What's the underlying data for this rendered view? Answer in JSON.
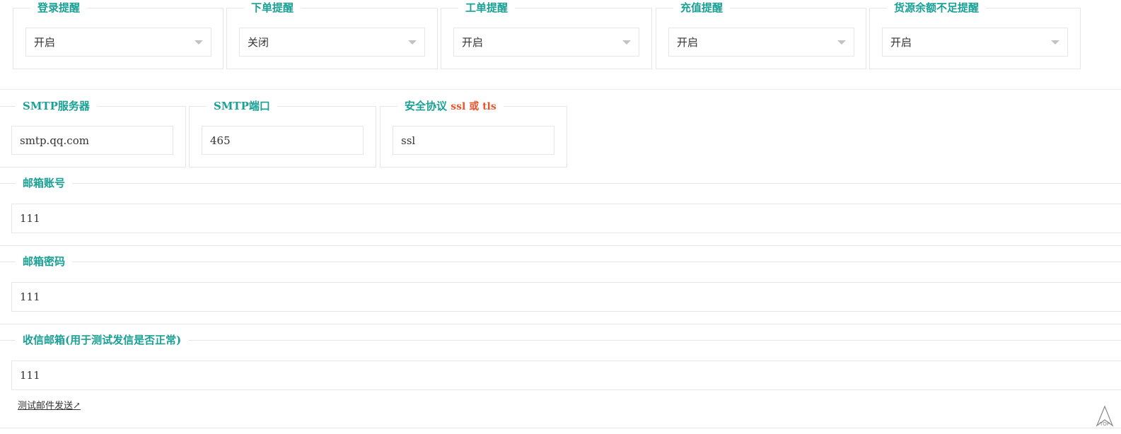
{
  "notify": [
    {
      "key": "login",
      "label": "登录提醒",
      "value": "开启"
    },
    {
      "key": "order",
      "label": "下单提醒",
      "value": "关闭"
    },
    {
      "key": "ticket",
      "label": "工单提醒",
      "value": "开启"
    },
    {
      "key": "recharge",
      "label": "充值提醒",
      "value": "开启"
    },
    {
      "key": "balance",
      "label": "货源余额不足提醒",
      "value": "开启"
    }
  ],
  "smtp": {
    "server_label": "SMTP服务器",
    "server_value": "smtp.qq.com",
    "port_label": "SMTP端口",
    "port_value": "465",
    "protocol_label": "安全协议",
    "protocol_hint": "ssl 或 tls",
    "protocol_value": "ssl"
  },
  "account": {
    "label": "邮箱账号",
    "value": "111"
  },
  "password": {
    "label": "邮箱密码",
    "value": "111"
  },
  "receiver": {
    "label": "收信邮箱(用于测试发信是否正常)",
    "value": "111"
  },
  "test_link": "测试邮件发送↗",
  "back_to_top": "TOP",
  "colors": {
    "accent": "#1aa094",
    "hint": "#e8552d",
    "border": "#e6e6e6"
  }
}
